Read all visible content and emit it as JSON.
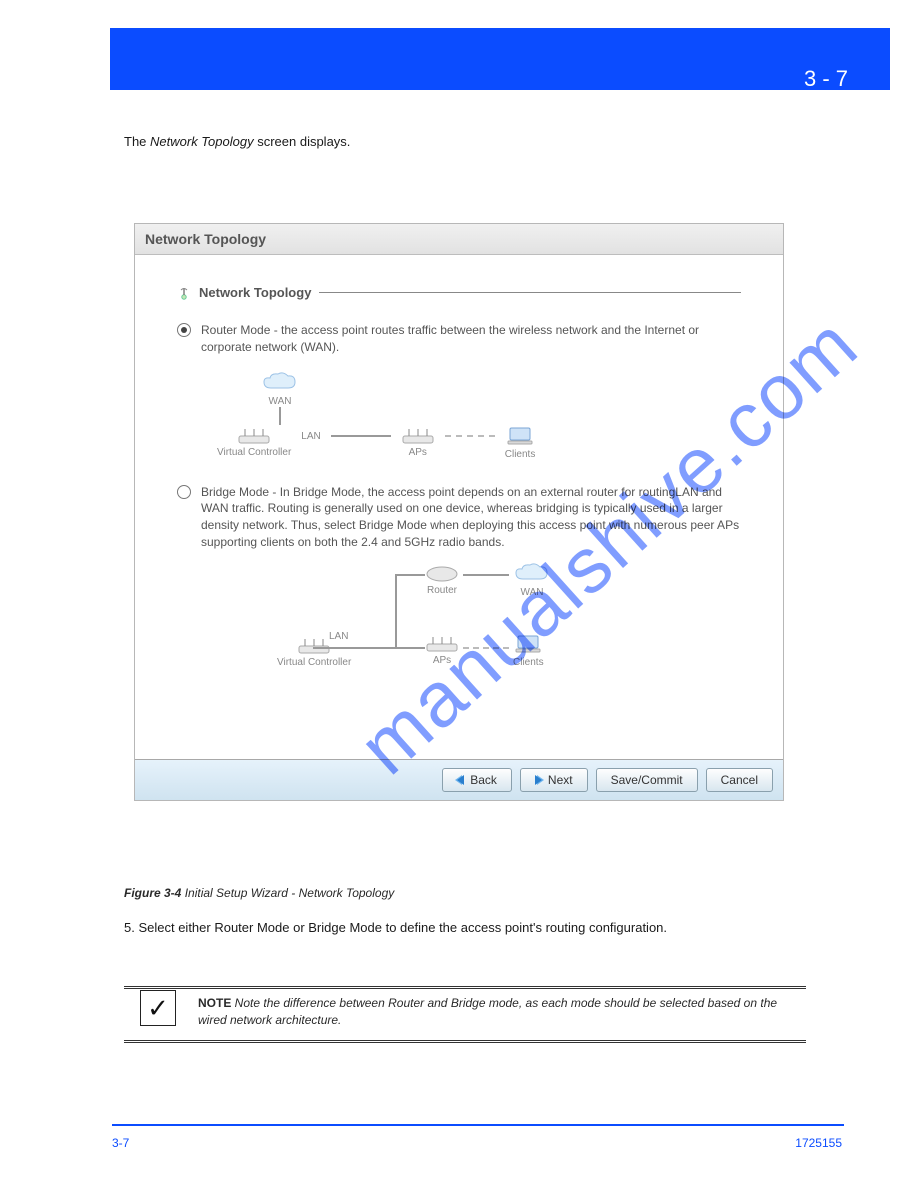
{
  "header": {
    "chapter": "3 - 7"
  },
  "intro": {
    "prefix": "The ",
    "em": "Network Topology",
    "suffix": " screen displays."
  },
  "panel": {
    "title": "Network Topology",
    "section_title": "Network Topology",
    "router": {
      "text": "Router Mode - the access point routes traffic between the wireless network and the Internet or corporate network (WAN).",
      "labels": {
        "wan": "WAN",
        "lan": "LAN",
        "vc": "Virtual Controller",
        "aps": "APs",
        "clients": "Clients"
      }
    },
    "bridge": {
      "text": "Bridge Mode - In Bridge Mode, the access point depends on an external router for routingLAN and WAN traffic. Routing is generally used on one device, whereas bridging is typically used in a larger density network. Thus, select Bridge Mode when deploying this access point with numerous peer APs supporting clients on both the 2.4 and 5GHz radio bands.",
      "labels": {
        "router": "Router",
        "wan": "WAN",
        "lan": "LAN",
        "vc": "Virtual Controller",
        "aps": "APs",
        "clients": "Clients"
      }
    },
    "buttons": {
      "back": "Back",
      "next": "Next",
      "save": "Save/Commit",
      "cancel": "Cancel"
    }
  },
  "watermark": "manualshive.com",
  "caption": {
    "fig": "Figure 3-4",
    "text": " Initial Setup Wizard - Network Topology"
  },
  "step5": "5. Select either Router Mode or Bridge Mode to define the access point's routing configuration.",
  "note": {
    "glyph": "✓",
    "label": "NOTE",
    "text": " Note the difference between Router and Bridge mode, as each mode should be selected based on the wired network architecture."
  },
  "footer": {
    "page": "3-7",
    "doc": "1725155"
  }
}
